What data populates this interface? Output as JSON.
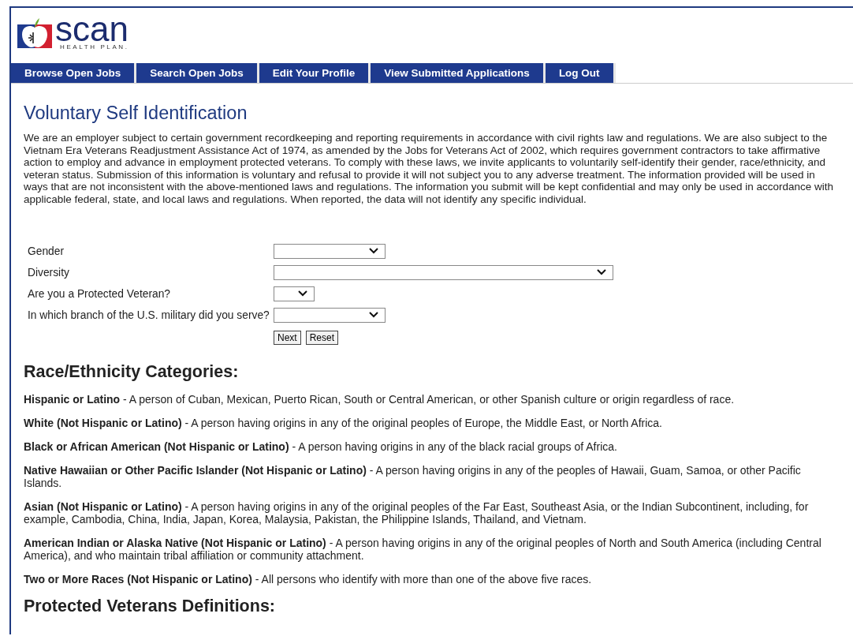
{
  "logo": {
    "name": "scan",
    "tagline": "HEALTH PLAN."
  },
  "nav": [
    {
      "label": "Browse Open Jobs"
    },
    {
      "label": "Search Open Jobs"
    },
    {
      "label": "Edit Your Profile"
    },
    {
      "label": "View Submitted Applications"
    },
    {
      "label": "Log Out"
    }
  ],
  "title": "Voluntary Self Identification",
  "intro": "We are an employer subject to certain government recordkeeping and reporting requirements in accordance with civil rights law and regulations. We are also subject to the Vietnam Era Veterans Readjustment Assistance Act of 1974, as amended by the Jobs for Veterans Act of 2002, which requires government contractors to take affirmative action to employ and advance in employment protected veterans. To comply with these laws, we invite applicants to voluntarily self-identify their gender, race/ethnicity, and veteran status. Submission of this information is voluntary and refusal to provide it will not subject you to any adverse treatment. The information provided will be used in ways that are not inconsistent with the above-mentioned laws and regulations. The information you submit will be kept confidential and may only be used in accordance with applicable federal, state, and local laws and regulations. When reported, the data will not identify any specific individual.",
  "form": {
    "fields": [
      {
        "label": "Gender"
      },
      {
        "label": "Diversity"
      },
      {
        "label": "Are you a Protected Veteran?"
      },
      {
        "label": "In which branch of the U.S. military did you serve?"
      }
    ],
    "buttons": [
      "Next",
      "Reset"
    ]
  },
  "race_heading": "Race/Ethnicity Categories:",
  "definitions": [
    "**Hispanic or Latino** - A person of Cuban, Mexican, Puerto Rican, South or Central American, or other Spanish culture or origin regardless of race.",
    "**White (Not Hispanic or Latino)** - A person having origins in any of the original peoples of Europe, the Middle East, or North Africa.",
    "**Black or African American (Not Hispanic or Latino)** - A person having origins in any of the black racial groups of Africa.",
    "**Native Hawaiian or Other Pacific Islander (Not Hispanic or Latino)** - A person having origins in any of the peoples of Hawaii, Guam, Samoa, or other Pacific Islands.",
    "**Asian (Not Hispanic or Latino)** - A person having origins in any of the original peoples of the Far East, Southeast Asia, or the Indian Subcontinent, including, for example, Cambodia, China, India, Japan, Korea, Malaysia, Pakistan, the Philippine Islands, Thailand, and Vietnam.",
    "**American Indian or Alaska Native (Not Hispanic or Latino)** - A person having origins in any of the original peoples of North and South America (including Central America), and who maintain tribal affiliation or community attachment.",
    "**Two or More Races (Not Hispanic or Latino)** - All persons who identify with more than one of the above five races."
  ],
  "veterans_heading": "Protected Veterans Definitions:"
}
